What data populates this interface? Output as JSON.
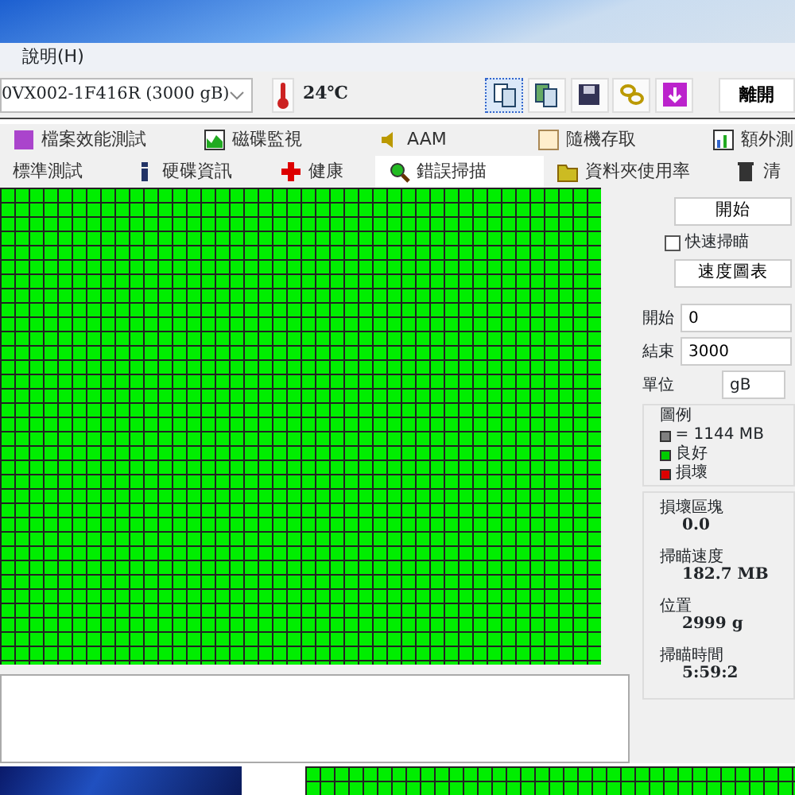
{
  "menu": [
    {
      "label": "說明(H)"
    }
  ],
  "toolbar": {
    "drive": "0VX002-1F416R (3000 gB)",
    "temperature": "24℃",
    "exit_button": "離開"
  },
  "tabs_row_1": [
    {
      "label": "檔案效能測試",
      "selected": false
    },
    {
      "label": "磁碟監視",
      "selected": false
    },
    {
      "label": "AAM",
      "selected": false
    },
    {
      "label": "隨機存取",
      "selected": false
    },
    {
      "label": "額外測",
      "selected": false
    }
  ],
  "tabs_row_2": [
    {
      "label": "標準測試",
      "selected": false
    },
    {
      "label": "硬碟資訊",
      "selected": false
    },
    {
      "label": "健康",
      "selected": false
    },
    {
      "label": "錯誤掃描",
      "selected": true
    },
    {
      "label": "資料夾使用率",
      "selected": false
    },
    {
      "label": "清",
      "selected": false
    }
  ],
  "side_panel": {
    "start_button": "開始",
    "quick_scan": {
      "label": "快速掃瞄",
      "checked": false
    },
    "speed_chart_button": "速度圖表",
    "fields": [
      {
        "label": "開始",
        "value": "0"
      },
      {
        "label": "結束",
        "value": "3000"
      }
    ],
    "unit": {
      "label": "單位",
      "value": "gB"
    },
    "legend": {
      "title": "圖例",
      "items": [
        {
          "label": "= 1144 MB",
          "color": "#808080"
        },
        {
          "label": "良好",
          "color": "#00cc00"
        },
        {
          "label": "損壞",
          "color": "#dd0000"
        }
      ]
    },
    "stats": [
      {
        "label": "損壞區塊",
        "value": "0.0"
      },
      {
        "label": "掃瞄速度",
        "value": "182.7 MB"
      },
      {
        "label": "位置",
        "value": "2999 g"
      },
      {
        "label": "掃瞄時間",
        "value": "5:59:2"
      }
    ]
  }
}
